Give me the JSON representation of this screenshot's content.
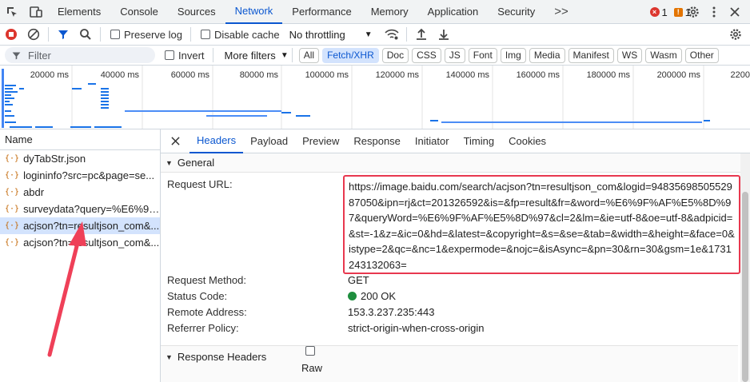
{
  "devtools": {
    "tabs": [
      "Elements",
      "Console",
      "Sources",
      "Network",
      "Performance",
      "Memory",
      "Application",
      "Security"
    ],
    "active_tab": "Network",
    "more_tabs": ">>",
    "error_count": "1",
    "warning_count": "1"
  },
  "toolbar": {
    "preserve_log": "Preserve log",
    "disable_cache": "Disable cache",
    "throttling": "No throttling"
  },
  "filterbar": {
    "filter_placeholder": "Filter",
    "invert": "Invert",
    "more_filters": "More filters",
    "chips": [
      "All",
      "Fetch/XHR",
      "Doc",
      "CSS",
      "JS",
      "Font",
      "Img",
      "Media",
      "Manifest",
      "WS",
      "Wasm",
      "Other"
    ],
    "selected_chip": "Fetch/XHR"
  },
  "overview": {
    "ticks": [
      "20000 ms",
      "40000 ms",
      "60000 ms",
      "80000 ms",
      "100000 ms",
      "120000 ms",
      "140000 ms",
      "160000 ms",
      "180000 ms",
      "200000 ms",
      "2200"
    ]
  },
  "request_list": {
    "header": "Name",
    "items": [
      {
        "name": "dyTabStr.json",
        "selected": false
      },
      {
        "name": "logininfo?src=pc&page=se...",
        "selected": false
      },
      {
        "name": "abdr",
        "selected": false
      },
      {
        "name": "surveydata?query=%E6%9F...",
        "selected": false
      },
      {
        "name": "acjson?tn=resultjson_com&...",
        "selected": true
      },
      {
        "name": "acjson?tn=resultjson_com&...",
        "selected": false
      }
    ]
  },
  "details": {
    "tabs": [
      "Headers",
      "Payload",
      "Preview",
      "Response",
      "Initiator",
      "Timing",
      "Cookies"
    ],
    "active_tab": "Headers",
    "general_label": "General",
    "request_url_label": "Request URL:",
    "request_url": "https://image.baidu.com/search/acjson?tn=resultjson_com&logid=9483569850552987050&ipn=rj&ct=201326592&is=&fp=result&fr=&word=%E6%9F%AF%E5%8D%97&queryWord=%E6%9F%AF%E5%8D%97&cl=2&lm=&ie=utf-8&oe=utf-8&adpicid=&st=-1&z=&ic=0&hd=&latest=&copyright=&s=&se=&tab=&width=&height=&face=0&istype=2&qc=&nc=1&expermode=&nojc=&isAsync=&pn=30&rn=30&gsm=1e&1731243132063=",
    "request_method_label": "Request Method:",
    "request_method": "GET",
    "status_code_label": "Status Code:",
    "status_code": "200 OK",
    "remote_address_label": "Remote Address:",
    "remote_address": "153.3.237.235:443",
    "referrer_policy_label": "Referrer Policy:",
    "referrer_policy": "strict-origin-when-cross-origin",
    "response_headers_label": "Response Headers",
    "raw_label": "Raw"
  },
  "colors": {
    "accent": "#0b57d0",
    "highlight_box": "#e8384f",
    "status_ok": "#1e8e3e"
  }
}
